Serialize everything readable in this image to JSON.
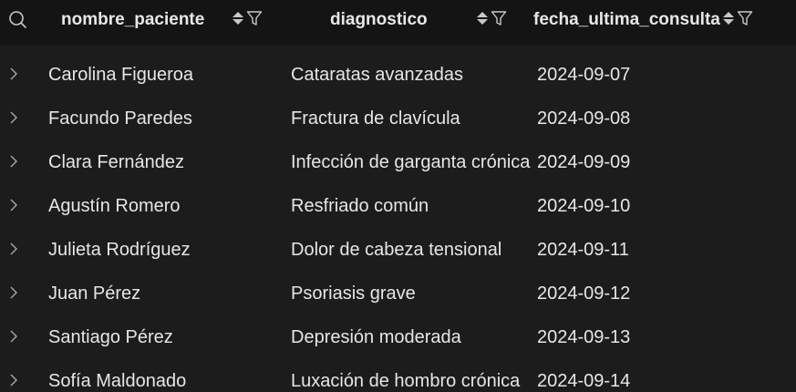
{
  "columns": [
    {
      "label": "nombre_paciente"
    },
    {
      "label": "diagnostico"
    },
    {
      "label": "fecha_ultima_consulta"
    }
  ],
  "rows": [
    {
      "nombre_paciente": "Carolina Figueroa",
      "diagnostico": "Cataratas avanzadas",
      "fecha_ultima_consulta": "2024-09-07"
    },
    {
      "nombre_paciente": "Facundo Paredes",
      "diagnostico": "Fractura de clavícula",
      "fecha_ultima_consulta": "2024-09-08"
    },
    {
      "nombre_paciente": "Clara Fernández",
      "diagnostico": "Infección de garganta crónica",
      "fecha_ultima_consulta": "2024-09-09"
    },
    {
      "nombre_paciente": "Agustín Romero",
      "diagnostico": "Resfriado común",
      "fecha_ultima_consulta": "2024-09-10"
    },
    {
      "nombre_paciente": "Julieta Rodríguez",
      "diagnostico": "Dolor de cabeza tensional",
      "fecha_ultima_consulta": "2024-09-11"
    },
    {
      "nombre_paciente": "Juan Pérez",
      "diagnostico": "Psoriasis grave",
      "fecha_ultima_consulta": "2024-09-12"
    },
    {
      "nombre_paciente": "Santiago Pérez",
      "diagnostico": "Depresión moderada",
      "fecha_ultima_consulta": "2024-09-13"
    },
    {
      "nombre_paciente": "Sofía Maldonado",
      "diagnostico": "Luxación de hombro crónica",
      "fecha_ultima_consulta": "2024-09-14"
    }
  ],
  "icons": {
    "search": "search-icon",
    "sort": "sort-icon",
    "filter": "filter-icon",
    "expand": "chevron-right-icon"
  },
  "colors": {
    "background": "#1c1c1c",
    "header_background": "#141414",
    "text": "#e6e6e6",
    "icon": "#c8c8c8"
  }
}
